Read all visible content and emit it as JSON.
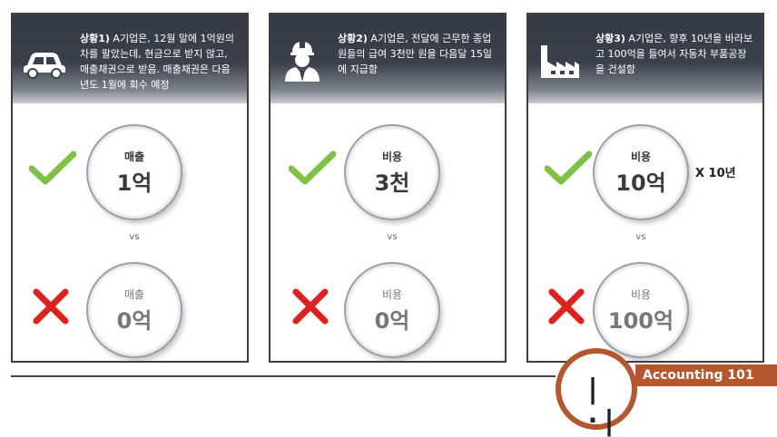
{
  "panels": [
    {
      "title": "상황1)",
      "text": " A기업은, 12월 말에 1억원의 차를 팔았는데, 현금으로 받지 않고, 매출채권으로 받음. 매출채권은 다음 년도 1월에 회수 예정",
      "icon": "car-icon",
      "top": {
        "label": "매출",
        "value": "1억"
      },
      "vs": "vs",
      "bottom": {
        "label": "매출",
        "value": "0억"
      },
      "note": ""
    },
    {
      "title": "상황2)",
      "text": " A기업은, 전달에 근무한 종업원들의 급여 3천만 원을 다음달 15일에 지급함",
      "icon": "worker-icon",
      "top": {
        "label": "비용",
        "value": "3천"
      },
      "vs": "vs",
      "bottom": {
        "label": "비용",
        "value": "0억"
      },
      "note": ""
    },
    {
      "title": "상황3)",
      "text": " A기업은, 향후 10년을 바라보고 100억을 들여서 자동차 부품공장을 건설함",
      "icon": "factory-icon",
      "top": {
        "label": "비용",
        "value": "10억"
      },
      "vs": "vs",
      "bottom": {
        "label": "비용",
        "value": "100억"
      },
      "note": "X 10년"
    }
  ],
  "brand": {
    "label": "Accounting 101",
    "color": "#b5562c"
  },
  "colors": {
    "check": "#7dc242",
    "cross": "#e0201b"
  }
}
